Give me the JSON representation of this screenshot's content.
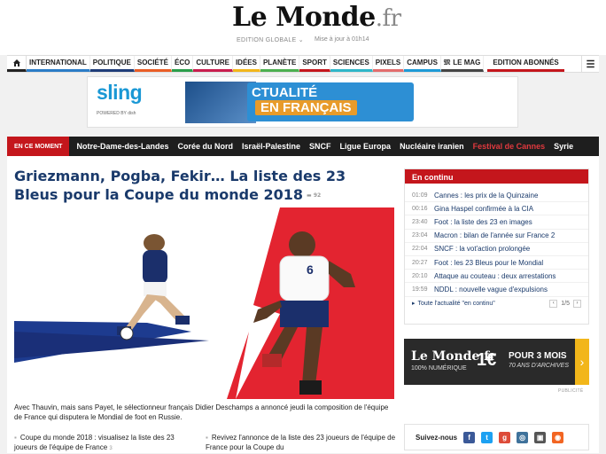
{
  "header": {
    "logo_main": "Le Monde",
    "logo_suffix": ".fr",
    "edition": "EDITION GLOBALE",
    "update": "Mise à jour à 01h14"
  },
  "nav": {
    "items": [
      {
        "label": "INTERNATIONAL",
        "color": "#2b7cc6"
      },
      {
        "label": "POLITIQUE",
        "color": "#1e3c78"
      },
      {
        "label": "SOCIÉTÉ",
        "color": "#e95d25"
      },
      {
        "label": "ÉCO",
        "color": "#2a9d4a"
      },
      {
        "label": "CULTURE",
        "color": "#c81d4e"
      },
      {
        "label": "IDÉES",
        "color": "#f2b61a"
      },
      {
        "label": "PLANÈTE",
        "color": "#4caf50"
      },
      {
        "label": "SPORT",
        "color": "#c4161c"
      },
      {
        "label": "SCIENCES",
        "color": "#2fb6c8"
      },
      {
        "label": "PIXELS",
        "color": "#e26d6d"
      },
      {
        "label": "CAMPUS",
        "color": "#1d9ad6"
      },
      {
        "label": "LE MAG",
        "color": "#444444"
      }
    ],
    "abonnes": "EDITION ABONNÉS"
  },
  "ad": {
    "brand": "sling",
    "brand_sub": "POWERED BY dish",
    "text1": "CTUALITÉ",
    "text2": "EN FRANÇAIS"
  },
  "moment": {
    "tag": "EN CE MOMENT",
    "items": [
      {
        "label": "Notre-Dame-des-Landes"
      },
      {
        "label": "Corée du Nord"
      },
      {
        "label": "Israël-Palestine"
      },
      {
        "label": "SNCF"
      },
      {
        "label": "Ligue Europa"
      },
      {
        "label": "Nucléaire iranien"
      },
      {
        "label": "Festival de Cannes"
      },
      {
        "label": "Syrie"
      }
    ]
  },
  "article": {
    "headline": "Griezmann, Pogba, Fekir… La liste des 23 Bleus pour la Coupe du monde 2018",
    "comments": "92",
    "caption": "Avec Thauvin, mais sans Payet, le sélectionneur français Didier Deschamps a annoncé jeudi la composition de l'équipe de France qui disputera le Mondial de foot en Russie.",
    "jersey": "6",
    "related1": "Coupe du monde 2018 : visualisez la liste des 23 joueurs de l'équipe de France",
    "related1_count": "3",
    "related2": "Revivez l'annonce de la liste des 23 joueurs de l'équipe de France pour la Coupe du"
  },
  "continu": {
    "title": "En continu",
    "rows": [
      {
        "time": "01:09",
        "text": "Cannes : les prix de la Quinzaine"
      },
      {
        "time": "00:16",
        "text": "Gina Haspel confirmée à la CIA"
      },
      {
        "time": "23:40",
        "text": "Foot : la liste des 23 en images"
      },
      {
        "time": "23:04",
        "text": "Macron : bilan de l'année sur France 2"
      },
      {
        "time": "22:04",
        "text": "SNCF : la vot'action prolongée"
      },
      {
        "time": "20:27",
        "text": "Foot : les 23 Bleus pour le Mondial"
      },
      {
        "time": "20:10",
        "text": "Attaque au couteau : deux arrestations"
      },
      {
        "time": "19:59",
        "text": "NDDL : nouvelle vague d'expulsions"
      }
    ],
    "footer_link": "Toute l'actualité \"en continu\"",
    "page": "1/5"
  },
  "promo": {
    "logo": "Le Monde.fr",
    "sub": "100% NUMÉRIQUE",
    "price": "1€",
    "pour": "POUR 3 MOIS",
    "archives": "70 ANS D'ARCHIVES"
  },
  "pub_label": "PUBLICITÉ",
  "follow": {
    "label": "Suivez-nous",
    "icons": [
      "facebook-icon",
      "twitter-icon",
      "googleplus-icon",
      "instagram-icon",
      "pinterest-icon",
      "rss-icon"
    ]
  }
}
